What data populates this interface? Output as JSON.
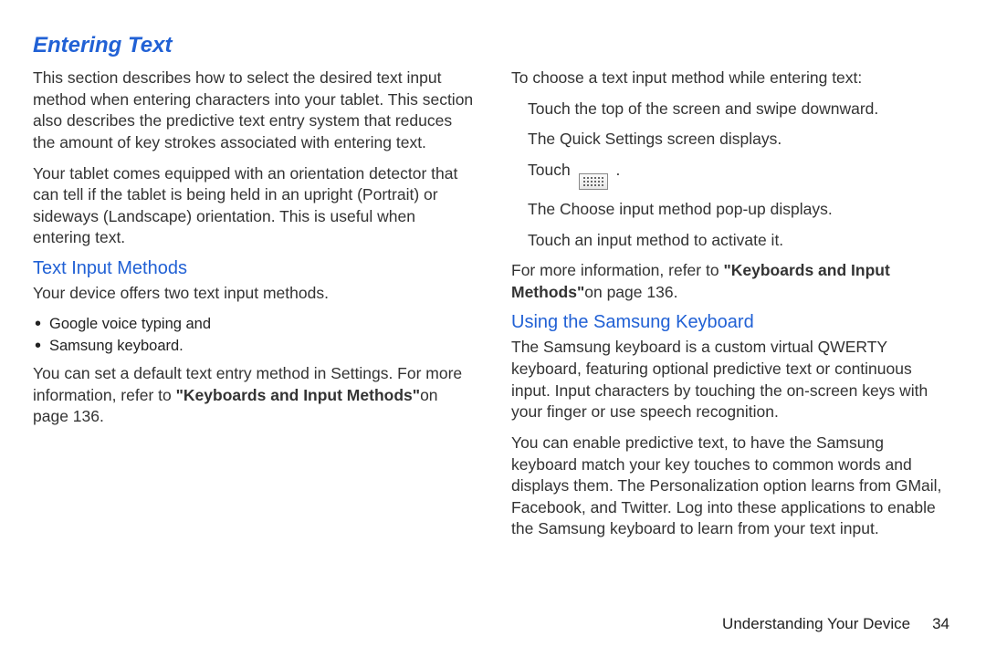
{
  "title": "Entering Text",
  "left": {
    "intro1": "This section describes how to select the desired text input method when entering characters into your tablet. This section also describes the predictive text entry system that reduces the amount of key strokes associated with entering text.",
    "intro2": "Your tablet comes equipped with an orientation detector that can tell if the tablet is being held in an upright (Portrait) or sideways (Landscape) orientation. This is useful when entering text.",
    "subhead": "Text Input Methods",
    "offers": "Your device offers two text input methods.",
    "bullets": [
      "Google voice typing and",
      "Samsung keyboard."
    ],
    "default_pre": "You can set a default text entry method in Settings. For more information, refer to ",
    "default_bold": "\"Keyboards and Input Methods\"",
    "default_post": "on page 136."
  },
  "right": {
    "choose_intro": "To choose a text input method while entering text:",
    "step1": "Touch the top of the screen and swipe downward.",
    "step1b": "The Quick Settings screen displays.",
    "step2a": "Touch ",
    "step2b": ".",
    "step2c": "The Choose input method pop-up displays.",
    "step3": "Touch an input method to activate it.",
    "more_pre": "For more information, refer to ",
    "more_bold": "\"Keyboards and Input Methods\"",
    "more_post": "on page 136.",
    "subhead": "Using the Samsung Keyboard",
    "kb1": "The Samsung keyboard is a custom virtual QWERTY keyboard, featuring optional predictive text or continuous input. Input characters by touching the on-screen keys with your finger or use speech recognition.",
    "kb2": "You can enable predictive text, to have the Samsung keyboard match your key touches to common words and displays them. The Personalization option learns from GMail, Facebook, and Twitter. Log into these applications to enable the Samsung keyboard to learn from your text input."
  },
  "footer": {
    "section": "Understanding Your Device",
    "page": "34"
  }
}
